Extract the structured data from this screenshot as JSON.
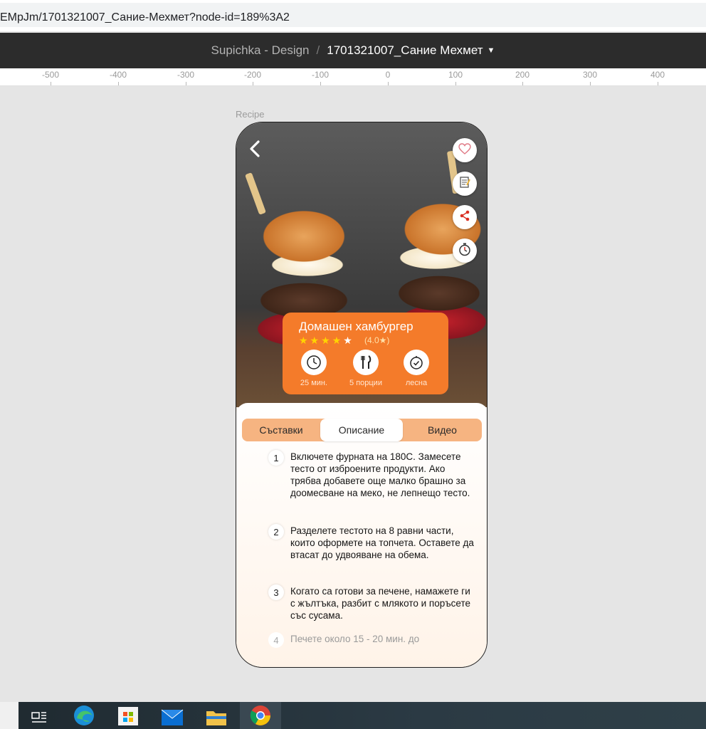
{
  "browser": {
    "url": "EMpJm/1701321007_Сание-Мехмет?node-id=189%3A2"
  },
  "figma": {
    "project": "Supichka - Design",
    "separator": "/",
    "file_name": "1701321007_Сание Мехмет",
    "ruler_ticks": [
      "-500",
      "-400",
      "-300",
      "-200",
      "-100",
      "0",
      "100",
      "200",
      "300",
      "400"
    ]
  },
  "frame": {
    "label": "Recipe"
  },
  "recipe": {
    "title": "Домашен хамбургер",
    "stars": "★★★★",
    "star_last": "★",
    "rating": "(4.0★)",
    "time": "25 мин.",
    "servings": "5 порции",
    "difficulty": "лесна"
  },
  "tabs": [
    "Съставки",
    "Описание",
    "Видео"
  ],
  "steps": [
    {
      "num": "1",
      "text": "Включете фурната на 180С. Замесете тесто от изброените продукти. Ако трябва добавете още малко брашно за доомесване на меко, не лепнещо тесто."
    },
    {
      "num": "2",
      "text": "Разделете тестото на 8 равни части, които оформете на топчета. Оставете да втасат до удвояване на обема."
    },
    {
      "num": "3",
      "text": "Когато са готови за печене, намажете ги с жълтъка, разбит с млякото и поръсете със сусама."
    },
    {
      "num": "4",
      "text": "Печете около 15 - 20 мин. до"
    }
  ],
  "colors": {
    "accent": "#f47b2a",
    "tab_bar": "#f6b481",
    "figma_bar": "#2c2c2c"
  },
  "icons": {
    "back": "chevron-left-icon",
    "favorite": "heart-icon",
    "notes": "notepad-icon",
    "share": "share-icon",
    "timer": "stopwatch-icon",
    "time": "clock-icon",
    "servings": "fork-knife-icon",
    "difficulty": "check-timer-icon"
  }
}
